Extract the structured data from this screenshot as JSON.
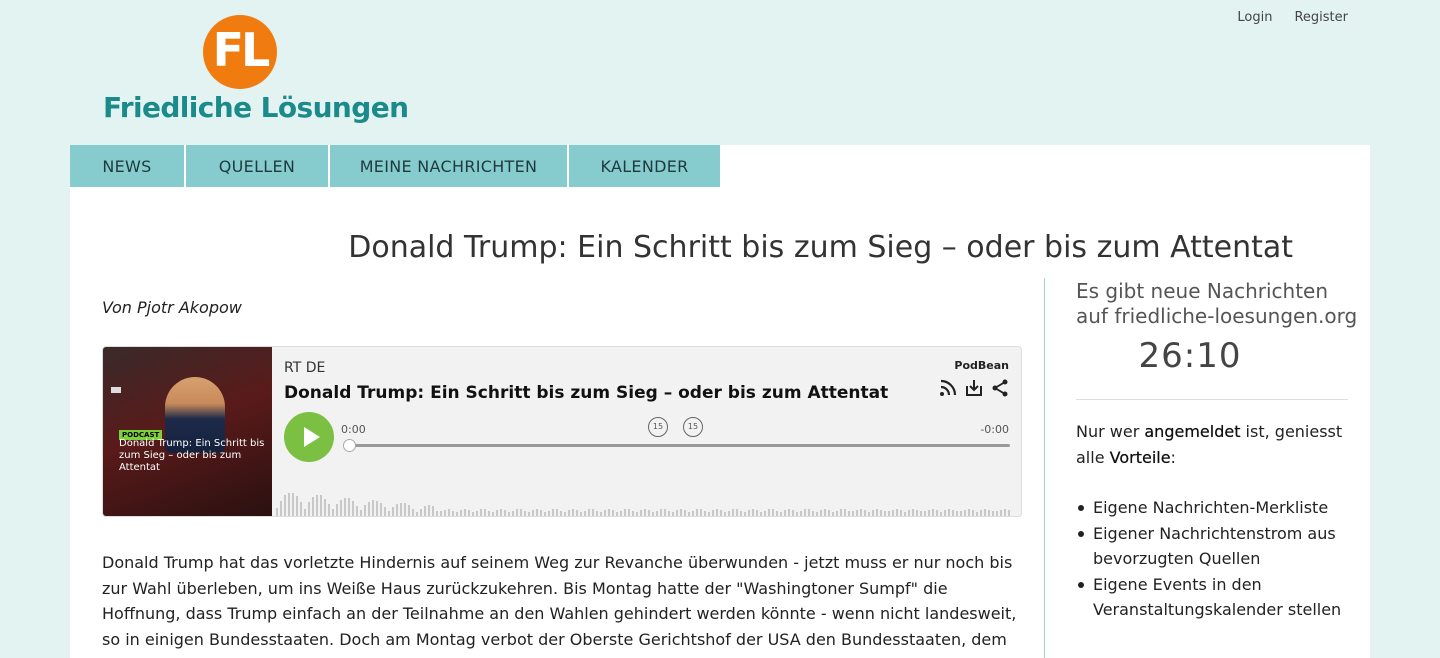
{
  "header": {
    "login_label": "Login",
    "register_label": "Register",
    "logo_monogram": "FL",
    "logo_text": "Friedliche Lösungen"
  },
  "nav": {
    "items": [
      {
        "label": "NEWS"
      },
      {
        "label": "QUELLEN"
      },
      {
        "label": "MEINE NACHRICHTEN"
      },
      {
        "label": "KALENDER"
      }
    ]
  },
  "article": {
    "title": "Donald Trump: Ein Schritt bis zum Sieg – oder bis zum Attentat",
    "author": "Von Pjotr Akopow",
    "body": "Donald Trump hat das vorletzte Hindernis auf seinem Weg zur Revanche überwunden - jetzt muss er nur noch bis zur Wahl überleben, um ins Weiße Haus zurückzukehren. Bis Montag hatte der \"Washingtoner Sumpf\" die Hoffnung, dass Trump einfach an der Teilnahme an den Wahlen gehindert werden könnte - wenn nicht landesweit, so in einigen Bundesstaaten. Doch am Montag verbot der Oberste Gerichtshof der USA den Bundesstaaten, dem Ex-Präsidenten den Zugang zu den Wahlen"
  },
  "player": {
    "source": "RT DE",
    "title": "Donald Trump: Ein Schritt bis zum Sieg – oder bis zum Attentat",
    "brand": "PodBean",
    "current_time": "0:00",
    "remaining_time": "-0:00",
    "skip_back": "15",
    "skip_forward": "15",
    "progress": 0,
    "thumb_badge": "PODCAST",
    "thumb_title": "Donald Trump: Ein Schritt bis zum Sieg – oder bis zum Attentat",
    "icons": [
      "rss-icon",
      "download-icon",
      "share-icon"
    ],
    "accent_color": "#7bc043"
  },
  "sidebar": {
    "new_messages": "Es gibt neue Nachrichten auf friedliche-loesungen.org",
    "timer": "26:10",
    "intro_before": "Nur wer ",
    "intro_bold1": "angemeldet",
    "intro_middle": " ist, geniesst alle ",
    "intro_bold2": "Vorteile",
    "intro_after": ":",
    "benefits": [
      "Eigene Nachrichten-Merkliste",
      "Eigener Nachrichtenstrom aus bevorzugten Quellen",
      "Eigene Events in den Veranstaltungskalender stellen"
    ]
  },
  "colors": {
    "background": "#e3f3f2",
    "nav": "#86cbcd",
    "logo_orange": "#f07c10",
    "logo_teal": "#1a8a8a"
  }
}
